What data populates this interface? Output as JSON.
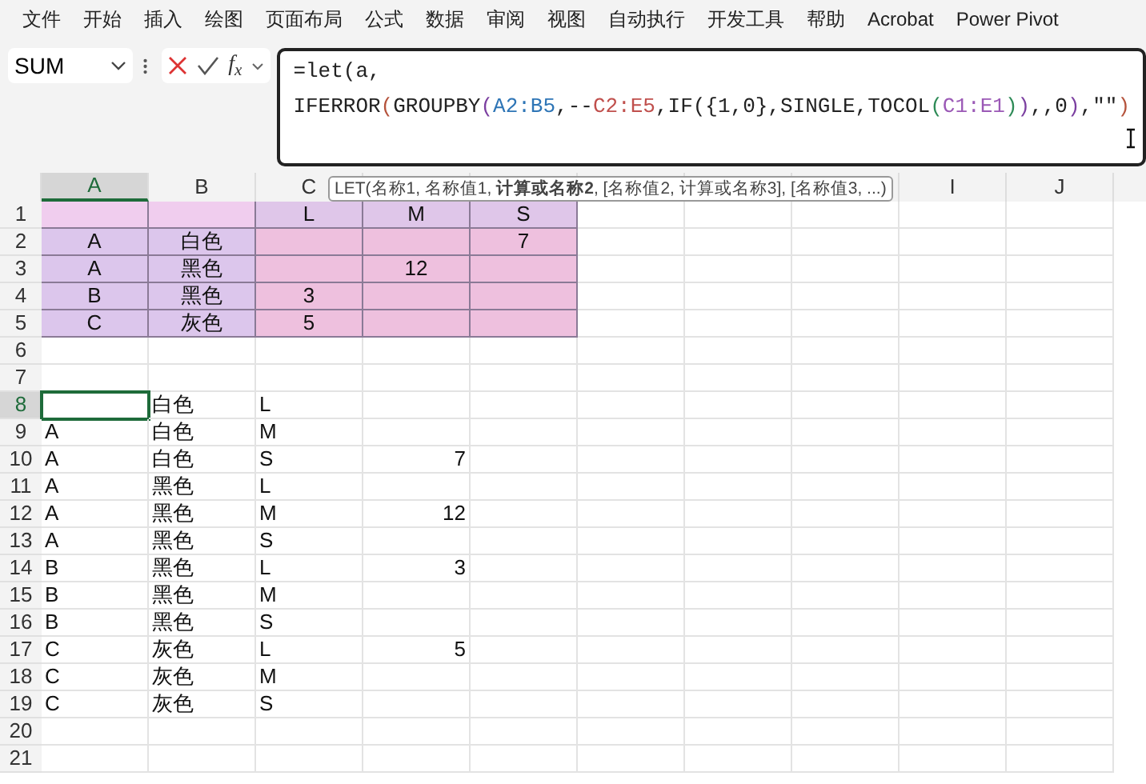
{
  "menu": [
    "文件",
    "开始",
    "插入",
    "绘图",
    "页面布局",
    "公式",
    "数据",
    "审阅",
    "视图",
    "自动执行",
    "开发工具",
    "帮助",
    "Acrobat",
    "Power Pivot"
  ],
  "name_box": {
    "value": "SUM"
  },
  "function_button": "f$_{x}$",
  "formula": {
    "lines": [
      [
        {
          "text": "=let"
        },
        {
          "text": "(a,"
        }
      ],
      [
        {
          "text": "IFERROR"
        },
        {
          "text": "(",
          "color": "#b5533c"
        },
        {
          "text": "GROUPBY"
        },
        {
          "text": "(",
          "color": "#7b3fa0"
        },
        {
          "text": "A2:B5",
          "color": "#2e75b6"
        },
        {
          "text": ",--"
        },
        {
          "text": "C2:E5",
          "color": "#c0504d"
        },
        {
          "text": ",IF({1,0},SINGLE,TOCOL"
        },
        {
          "text": "(",
          "color": "#2e8b57"
        },
        {
          "text": "C1:E1",
          "color": "#9b59b6"
        },
        {
          "text": ")",
          "color": "#2e8b57"
        },
        {
          "text": ")",
          "color": "#7b3fa0"
        },
        {
          "text": ",,0"
        },
        {
          "text": ")",
          "color": "#7b3fa0"
        },
        {
          "text": ",\"\""
        },
        {
          "text": ")",
          "color": "#b5533c"
        }
      ]
    ]
  },
  "tooltip": "LET(名称1, 名称值1, **计算或名称2**, [名称值2, 计算或名称3], [名称值3, ...)",
  "columns": [
    {
      "label": "A",
      "selected": true
    },
    {
      "label": "B",
      "selected": false
    },
    {
      "label": "C",
      "selected": false
    },
    {},
    {},
    {},
    {},
    {},
    {
      "label": "I",
      "selected": false
    },
    {
      "label": "J",
      "selected": false
    }
  ],
  "rows": [
    {
      "label": "1",
      "selected": false,
      "kind": "source",
      "cells": [
        {
          "color": "#f0cdee"
        },
        {
          "color": "#f0cdee"
        },
        {
          "text": "L",
          "color": "#dfc6e9"
        },
        {
          "text": "M",
          "color": "#dfc6e9"
        },
        {
          "text": "S",
          "color": "#dfc6e9"
        }
      ]
    },
    {
      "label": "2",
      "selected": false,
      "kind": "source",
      "cells": [
        {
          "text": "A",
          "color": "#dcc6ec"
        },
        {
          "text": "白色",
          "color": "#dcc6ec"
        },
        {
          "color": "#eec0de"
        },
        {
          "color": "#eec0de"
        },
        {
          "text": "7",
          "color": "#eec0de"
        }
      ]
    },
    {
      "label": "3",
      "selected": false,
      "kind": "source",
      "cells": [
        {
          "text": "A",
          "color": "#dcc6ec"
        },
        {
          "text": "黑色",
          "color": "#dcc6ec"
        },
        {
          "color": "#eec0de"
        },
        {
          "text": "12",
          "color": "#eec0de"
        },
        {
          "color": "#eec0de"
        }
      ]
    },
    {
      "label": "4",
      "selected": false,
      "kind": "source",
      "cells": [
        {
          "text": "B",
          "color": "#dcc6ec"
        },
        {
          "text": "黑色",
          "color": "#dcc6ec"
        },
        {
          "text": "3",
          "color": "#eec0de"
        },
        {
          "color": "#eec0de"
        },
        {
          "color": "#eec0de"
        }
      ]
    },
    {
      "label": "5",
      "selected": false,
      "kind": "source",
      "cells": [
        {
          "text": "C",
          "color": "#dcc6ec"
        },
        {
          "text": "灰色",
          "color": "#dcc6ec"
        },
        {
          "text": "5",
          "color": "#eec0de"
        },
        {
          "color": "#eec0de"
        },
        {
          "color": "#eec0de"
        }
      ]
    },
    {
      "label": "6",
      "selected": false,
      "cells": []
    },
    {
      "label": "7",
      "selected": false,
      "cells": []
    },
    {
      "label": "8",
      "selected": true,
      "kind": "output",
      "cells": [
        {
          "selected": true
        },
        {
          "text": "白色"
        },
        {
          "text": "L"
        },
        {}
      ]
    },
    {
      "label": "9",
      "selected": false,
      "kind": "output",
      "cells": [
        {
          "text": "A"
        },
        {
          "text": "白色"
        },
        {
          "text": "M"
        },
        {}
      ]
    },
    {
      "label": "10",
      "selected": false,
      "kind": "output",
      "cells": [
        {
          "text": "A"
        },
        {
          "text": "白色"
        },
        {
          "text": "S"
        },
        {
          "text": "7"
        }
      ]
    },
    {
      "label": "11",
      "selected": false,
      "kind": "output",
      "cells": [
        {
          "text": "A"
        },
        {
          "text": "黑色"
        },
        {
          "text": "L"
        },
        {}
      ]
    },
    {
      "label": "12",
      "selected": false,
      "kind": "output",
      "cells": [
        {
          "text": "A"
        },
        {
          "text": "黑色"
        },
        {
          "text": "M"
        },
        {
          "text": "12"
        }
      ]
    },
    {
      "label": "13",
      "selected": false,
      "kind": "output",
      "cells": [
        {
          "text": "A"
        },
        {
          "text": "黑色"
        },
        {
          "text": "S"
        },
        {}
      ]
    },
    {
      "label": "14",
      "selected": false,
      "kind": "output",
      "cells": [
        {
          "text": "B"
        },
        {
          "text": "黑色"
        },
        {
          "text": "L"
        },
        {
          "text": "3"
        }
      ]
    },
    {
      "label": "15",
      "selected": false,
      "kind": "output",
      "cells": [
        {
          "text": "B"
        },
        {
          "text": "黑色"
        },
        {
          "text": "M"
        },
        {}
      ]
    },
    {
      "label": "16",
      "selected": false,
      "kind": "output",
      "cells": [
        {
          "text": "B"
        },
        {
          "text": "黑色"
        },
        {
          "text": "S"
        },
        {}
      ]
    },
    {
      "label": "17",
      "selected": false,
      "kind": "output",
      "cells": [
        {
          "text": "C"
        },
        {
          "text": "灰色"
        },
        {
          "text": "L"
        },
        {
          "text": "5"
        }
      ]
    },
    {
      "label": "18",
      "selected": false,
      "kind": "output",
      "cells": [
        {
          "text": "C"
        },
        {
          "text": "灰色"
        },
        {
          "text": "M"
        },
        {}
      ]
    },
    {
      "label": "19",
      "selected": false,
      "kind": "output",
      "cells": [
        {
          "text": "C"
        },
        {
          "text": "灰色"
        },
        {
          "text": "S"
        },
        {}
      ]
    },
    {
      "label": "20",
      "selected": false,
      "cells": []
    },
    {
      "label": "21",
      "selected": false,
      "cells": []
    }
  ]
}
